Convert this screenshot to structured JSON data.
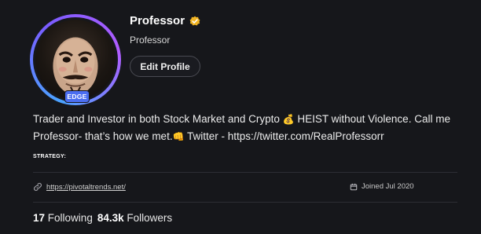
{
  "profile": {
    "display_name": "Professor",
    "username": "Professor",
    "tier_badge": "EDGE",
    "edit_button": "Edit Profile",
    "bio": {
      "part1": "Trader and Investor in both Stock Market and Crypto ",
      "emoji1": "💰",
      "part2": " HEIST without Violence. Call me Professor- that’s how we met.",
      "emoji2": "👊",
      "part3": " Twitter - https://twitter.com/RealProfessorr"
    },
    "strategy_label": "STRATEGY:",
    "website": "https://pivotaltrends.net/",
    "joined": "Joined Jul 2020",
    "following_count": "17",
    "following_label": "Following",
    "followers_count": "84.3k",
    "followers_label": "Followers"
  },
  "colors": {
    "background": "#16171b",
    "badge": "#4b6ef0",
    "verified": "#f2b524",
    "ring_start": "#4aa3ff",
    "ring_end": "#b25cff"
  },
  "icons": {
    "verified": "verified-badge-icon",
    "link": "link-icon",
    "calendar": "calendar-icon"
  }
}
